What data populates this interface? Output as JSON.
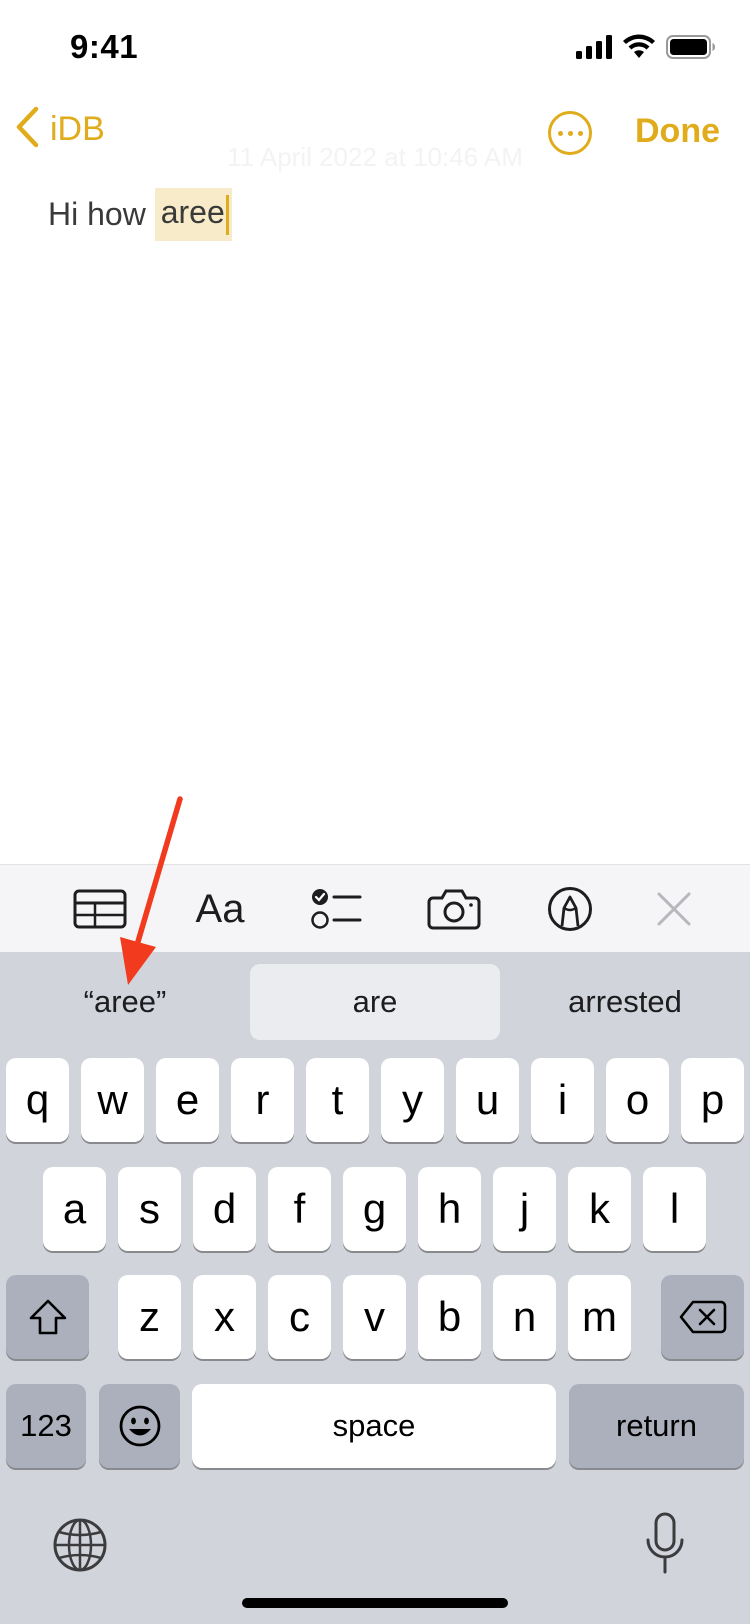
{
  "status_bar": {
    "time": "9:41"
  },
  "nav": {
    "back_label": "iDB",
    "done_label": "Done"
  },
  "note": {
    "date": "11 April 2022 at 10:46 AM",
    "prefix": "Hi how ",
    "highlighted_word": "aree"
  },
  "format_toolbar": {
    "items": [
      "table-icon",
      "Aa",
      "checklist-icon",
      "camera-icon",
      "markup-icon",
      "close-icon"
    ],
    "text_style_label": "Aa"
  },
  "keyboard": {
    "suggestions": [
      "“aree”",
      "are",
      "arrested"
    ],
    "row1": [
      "q",
      "w",
      "e",
      "r",
      "t",
      "y",
      "u",
      "i",
      "o",
      "p"
    ],
    "row2": [
      "a",
      "s",
      "d",
      "f",
      "g",
      "h",
      "j",
      "k",
      "l"
    ],
    "row3": [
      "z",
      "x",
      "c",
      "v",
      "b",
      "n",
      "m"
    ],
    "numbers_label": "123",
    "space_label": "space",
    "return_label": "return"
  },
  "colors": {
    "accent": "#e0ac1b",
    "highlight": "#f7ebc9",
    "annotation_arrow": "#f23a1e"
  }
}
